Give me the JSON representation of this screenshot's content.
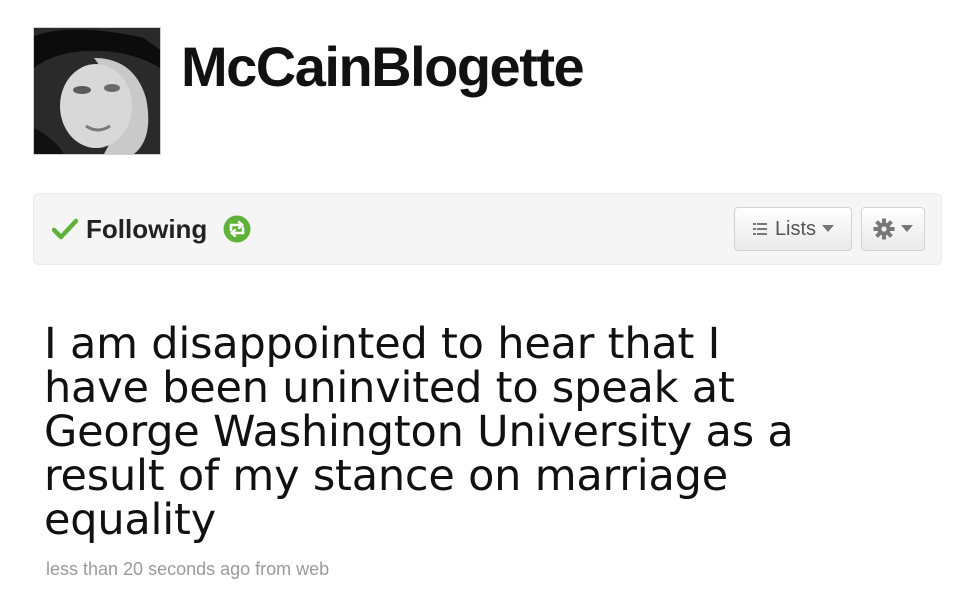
{
  "profile": {
    "username": "McCainBlogette",
    "avatar_icon": "profile-photo"
  },
  "action_bar": {
    "following_label": "Following",
    "following_icon": "check-icon",
    "retweets_icon": "retweet-icon",
    "lists_label": "Lists",
    "lists_icon": "list-icon",
    "settings_icon": "gear-icon",
    "accent_green": "#5fb13a"
  },
  "tweet": {
    "text": "I am disappointed to hear that I have been uninvited to speak at George Washington University as a result of my stance on marriage equality",
    "meta": "less than 20 seconds ago from web"
  }
}
